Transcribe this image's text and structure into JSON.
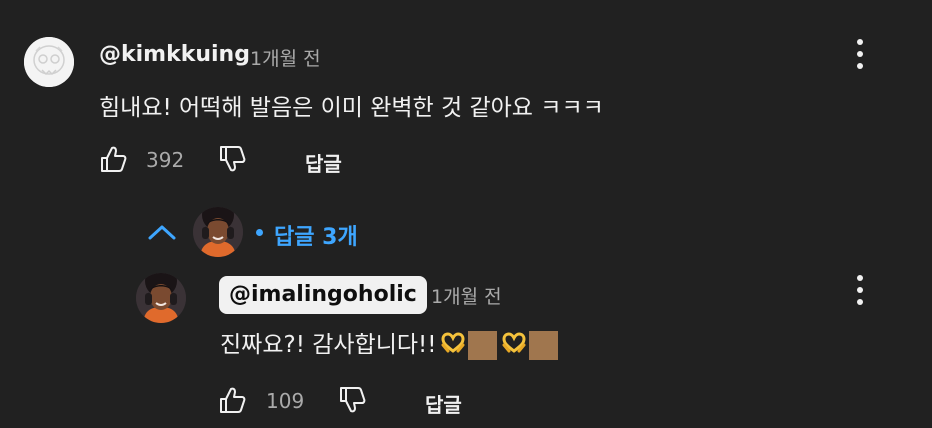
{
  "comment": {
    "author": "@kimkkuing",
    "timestamp": "1개월 전",
    "text": "힘내요! 어떡해 발음은 이미 완벽한 것 같아요 ㅋㅋㅋ",
    "likes": "392",
    "reply_label": "답글",
    "avatar_icon": "skull-avatar-icon"
  },
  "replies_toggle": {
    "label": "답글 3개",
    "color": "#3ea6ff"
  },
  "reply": {
    "author": "@imalingoholic",
    "timestamp": "1개월 전",
    "text": "진짜요?! 감사합니다!!",
    "emojis": [
      "heart-hands-icon",
      "skin-tone-swatch",
      "heart-hands-icon",
      "skin-tone-swatch"
    ],
    "likes": "109",
    "reply_label": "답글"
  },
  "colors": {
    "background": "#212121",
    "text": "#f1f1f1",
    "secondary": "#aaaaaa",
    "accent": "#3ea6ff",
    "skin_tone": "#a0764e"
  }
}
